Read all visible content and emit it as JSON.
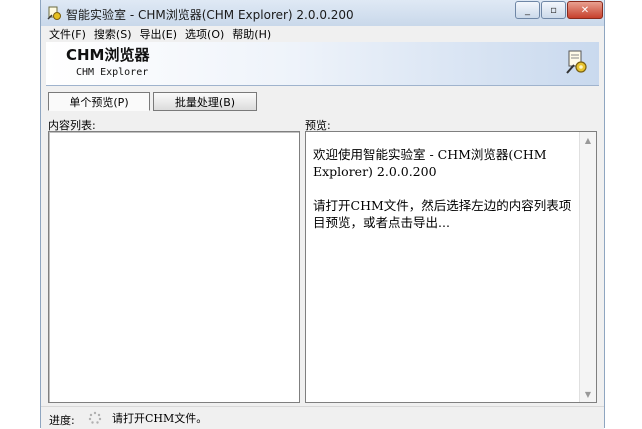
{
  "window": {
    "title": "智能实验室 - CHM浏览器(CHM Explorer) 2.0.0.200",
    "min_icon": "_",
    "max_icon": "▫",
    "close_icon": "✕"
  },
  "menu": {
    "items": [
      {
        "label": "文件(F)"
      },
      {
        "label": "搜索(S)"
      },
      {
        "label": "导出(E)"
      },
      {
        "label": "选项(O)"
      },
      {
        "label": "帮助(H)"
      }
    ]
  },
  "banner": {
    "title": "CHM浏览器",
    "subtitle": "CHM Explorer"
  },
  "tabs": [
    {
      "label": "单个预览(P)",
      "active": true
    },
    {
      "label": "批量处理(B)",
      "active": false
    }
  ],
  "list_panel": {
    "label": "内容列表:"
  },
  "preview_panel": {
    "label": "预览:",
    "line1": "欢迎使用智能实验室 - CHM浏览器(CHM Explorer) 2.0.0.200",
    "line2": "请打开CHM文件，然后选择左边的内容列表项目预览，或者点击导出..."
  },
  "status": {
    "label": "进度:",
    "text": "请打开CHM文件。"
  },
  "icons": {
    "app": "app-icon",
    "banner": "gear-pen-icon",
    "status": "spinner-icon"
  }
}
